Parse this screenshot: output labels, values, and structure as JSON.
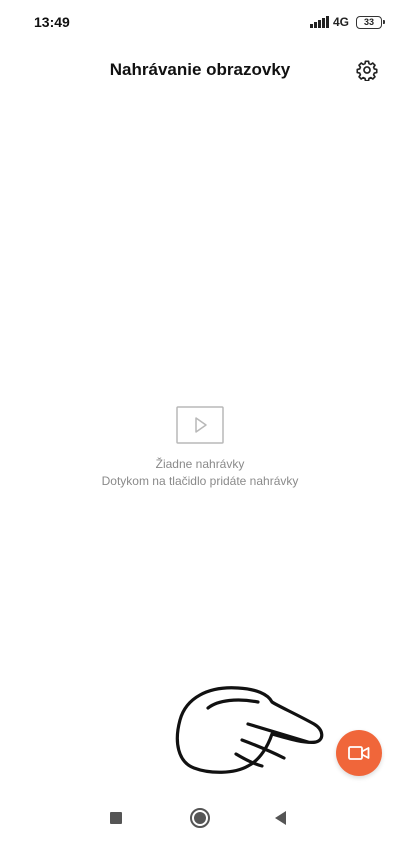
{
  "status_bar": {
    "time": "13:49",
    "network": "4G",
    "network_sub": "",
    "battery": "33",
    "icons": [
      "signal-icon",
      "battery-icon"
    ]
  },
  "header": {
    "title": "Nahrávanie obrazovky",
    "settings_icon": "gear-icon"
  },
  "empty_state": {
    "icon": "video-play-icon",
    "title": "Žiadne nahrávky",
    "hint": "Dotykom na tlačidlo pridáte nahrávky"
  },
  "fab": {
    "icon": "video-camera-icon",
    "color": "#f0663a"
  },
  "overlay": {
    "icon": "hand-pointer-icon"
  },
  "nav_bar": {
    "icons": [
      "recent-apps-icon",
      "home-icon",
      "back-icon"
    ]
  },
  "colors": {
    "accent": "#f0663a",
    "muted_text": "#8a8a8a",
    "placeholder_icon": "#b8b8b8"
  }
}
